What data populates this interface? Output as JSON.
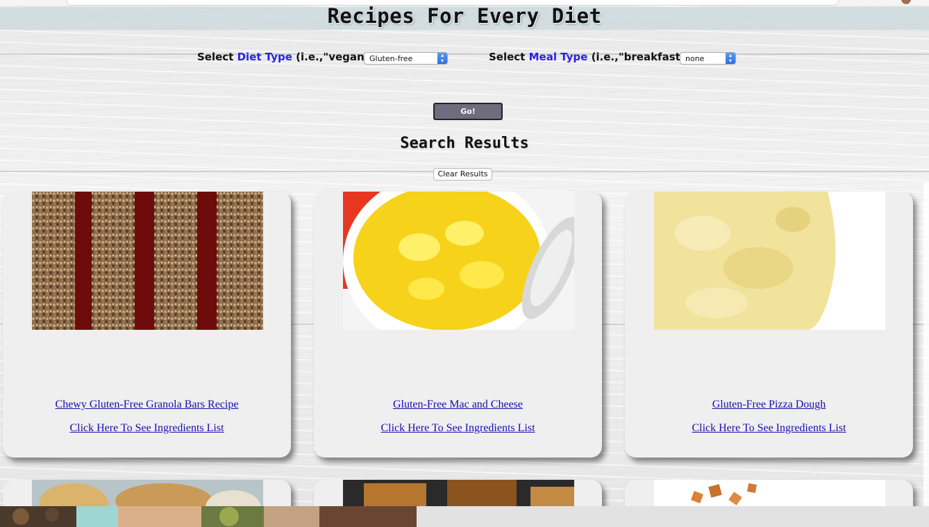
{
  "site": {
    "title": "Recipes For Every Diet"
  },
  "filters": {
    "diet": {
      "prefix": "Select",
      "highlight": "Diet Type",
      "suffix": "(i.e.,\"vegan\"):",
      "selected": "Gluten-free"
    },
    "meal": {
      "prefix": "Select",
      "highlight": "Meal Type",
      "suffix": "(i.e.,\"breakfast\"):",
      "selected": "none"
    },
    "go_label": "Go!"
  },
  "results": {
    "title": "Search Results",
    "clear_label": "Clear Results",
    "ingredients_label": "Click Here To See Ingredients List",
    "items": [
      {
        "name": "Chewy Gluten-Free Granola Bars Recipe",
        "image": "granola-bars-image"
      },
      {
        "name": "Gluten-Free Mac and Cheese",
        "image": "mac-and-cheese-image"
      },
      {
        "name": "Gluten-Free Pizza Dough",
        "image": "pizza-dough-image"
      }
    ]
  },
  "colors": {
    "highlight": "#2b22e0",
    "link": "#1a0dab",
    "card": "#efefef",
    "go_button": "#6d6d7e"
  }
}
